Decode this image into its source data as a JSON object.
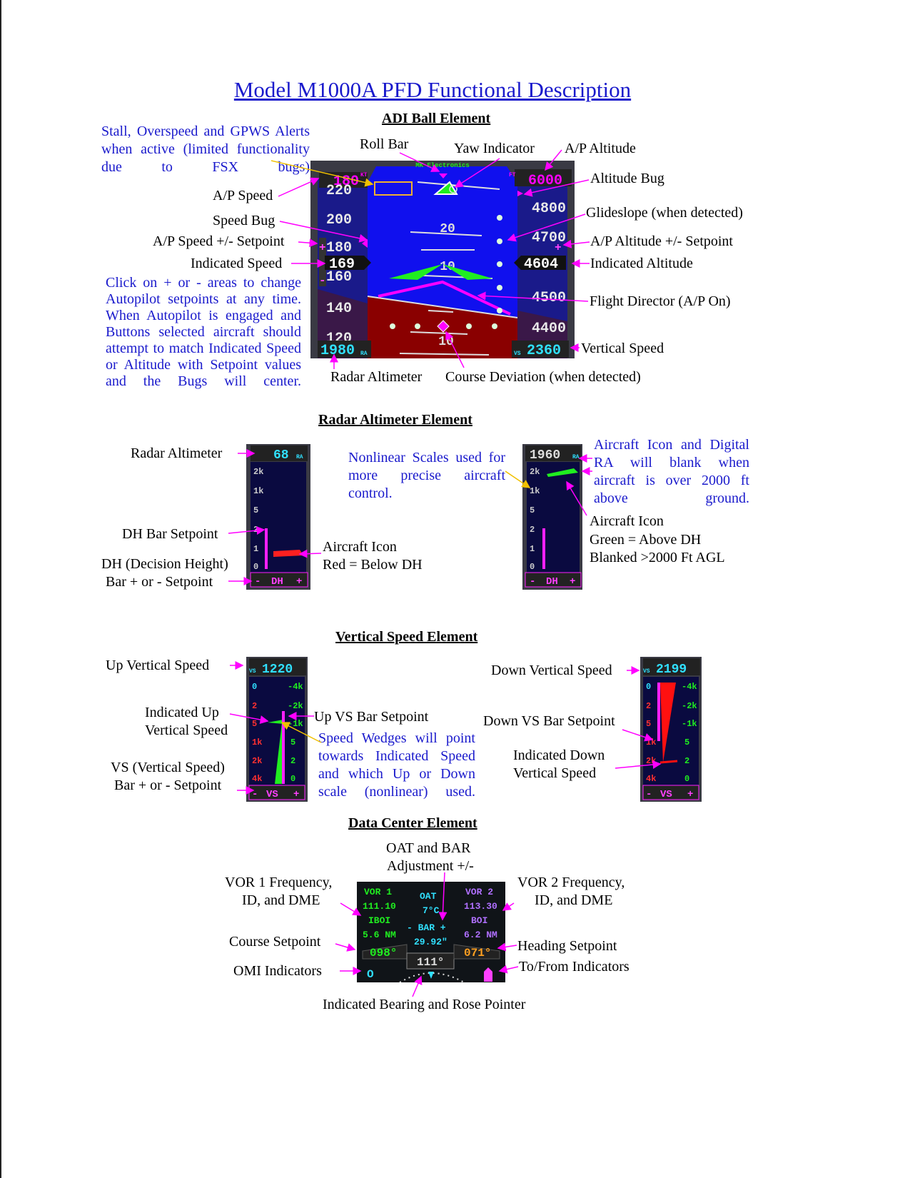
{
  "title": "Model M1000A PFD Functional Description",
  "colors": {
    "text_blue": "#1a1acc",
    "arrow_magenta": "#ff00ff",
    "arrow_yellow": "#f0c000",
    "sky": "#1010ee",
    "ground": "#8a0000",
    "green": "#20ee20",
    "cyan": "#30e0ff"
  },
  "adi": {
    "heading": "ADI Ball Element",
    "note_alerts": "Stall, Overspeed and GPWS Alerts when active (limited functionality due to FSX bugs)",
    "note_click": "Click on + or - areas to change Autopilot setpoints at any time. When Autopilot is engaged and Buttons selected aircraft should attempt to match Indicated Speed or Altitude with Setpoint values and the Bugs will center.",
    "labels": {
      "roll_bar": "Roll Bar",
      "yaw": "Yaw Indicator",
      "ap_alt": "A/P Altitude",
      "alt_bug": "Altitude Bug",
      "glideslope": "Glideslope (when detected)",
      "ap_alt_setpoint": "A/P Altitude +/- Setpoint",
      "ind_alt": "Indicated Altitude",
      "fd": "Flight Director (A/P On)",
      "vs": "Vertical Speed",
      "ap_speed": "A/P Speed",
      "speed_bug": "Speed Bug",
      "ap_speed_setpoint": "A/P Speed +/- Setpoint",
      "ind_speed": "Indicated Speed",
      "radar_alt": "Radar Altimeter",
      "course_dev": "Course Deviation (when detected)"
    },
    "display": {
      "brand": "MK Electronics",
      "ap_speed": "180",
      "kt": "KT",
      "ap_alt": "6000",
      "ft": "FT",
      "speed_ticks": [
        "220",
        "200",
        "180",
        "160",
        "140",
        "120"
      ],
      "ind_speed": "169",
      "alt_ticks": [
        "4800",
        "4700",
        "4500",
        "4400"
      ],
      "ind_alt": "4604",
      "pitch_up": "20",
      "pitch_mid": "10",
      "pitch_down": "10",
      "radar_alt": "1980",
      "ra": "RA",
      "vs": "2360",
      "vs_label": "VS",
      "plus": "+",
      "minus": "-"
    }
  },
  "radar": {
    "heading": "Radar Altimeter Element",
    "labels": {
      "radar_alt": "Radar Altimeter",
      "dh_bar": "DH Bar Setpoint",
      "dh1": "DH (Decision Height)",
      "dh2": "Bar + or -  Setpoint",
      "icon_red1": "Aircraft Icon",
      "icon_red2": "Red = Below DH",
      "note_nonlinear": "Nonlinear Scales used for more precise aircraft control.",
      "note_blank": "Aircraft Icon and Digital RA will blank when aircraft is over 2000 ft above ground.",
      "icon_green1": "Aircraft Icon",
      "icon_green2": "Green = Above DH",
      "icon_green3": "Blanked >2000 Ft AGL"
    },
    "left": {
      "value": "68",
      "ra": "RA",
      "scale": [
        "2k",
        "1k",
        "5",
        "2",
        "1",
        "0"
      ],
      "dh": "DH"
    },
    "right": {
      "value": "1960",
      "ra": "RA",
      "scale": [
        "2k",
        "1k",
        "5",
        "2",
        "1",
        "0"
      ],
      "dh": "DH"
    }
  },
  "vs": {
    "heading": "Vertical Speed Element",
    "labels": {
      "up_vs": "Up Vertical Speed",
      "ind_up1": "Indicated Up",
      "ind_up2": "Vertical Speed",
      "up_bar": "Up VS Bar Setpoint",
      "vs_bar1": "VS (Vertical Speed)",
      "vs_bar2": "Bar + or -  Setpoint",
      "note_wedges": "Speed Wedges will point towards Indicated Speed and which Up or Down scale (nonlinear) used.",
      "down_vs": "Down Vertical Speed",
      "down_bar": "Down VS Bar Setpoint",
      "ind_down1": "Indicated Down",
      "ind_down2": "Vertical Speed"
    },
    "left": {
      "value": "1220",
      "label": "VS",
      "left_scale": [
        "0",
        "2",
        "5",
        "1k",
        "2k",
        "4k"
      ],
      "right_scale": [
        "-4k",
        "-2k",
        "-1k",
        "5",
        "2",
        "0"
      ]
    },
    "right": {
      "value": "2199",
      "label": "VS",
      "left_scale": [
        "0",
        "2",
        "5",
        "1k",
        "2k",
        "4k"
      ],
      "right_scale": [
        "-4k",
        "-2k",
        "-1k",
        "5",
        "2",
        "0"
      ]
    }
  },
  "dc": {
    "heading": "Data Center Element",
    "labels": {
      "oat_bar1": "OAT and BAR",
      "oat_bar2": "Adjustment +/-",
      "vor1a": "VOR 1 Frequency,",
      "vor1b": "ID, and DME",
      "vor2a": "VOR 2 Frequency,",
      "vor2b": "ID, and DME",
      "course": "Course Setpoint",
      "heading_sp": "Heading Setpoint",
      "omi": "OMI Indicators",
      "tofrom": "To/From Indicators",
      "bearing": "Indicated Bearing and Rose Pointer"
    },
    "display": {
      "vor1": "VOR 1",
      "vor1_freq": "111.10",
      "vor1_id": "IBOI",
      "vor1_dme": "5.6 NM",
      "oat": "OAT",
      "oat_val": "7°C",
      "bar": "- BAR +",
      "bar_val": "29.92\"",
      "vor2": "VOR 2",
      "vor2_freq": "113.30",
      "vor2_id": "BOI",
      "vor2_dme": "6.2 NM",
      "course": "098°",
      "bearing": "111°",
      "heading": "071°",
      "omi": "O"
    }
  }
}
